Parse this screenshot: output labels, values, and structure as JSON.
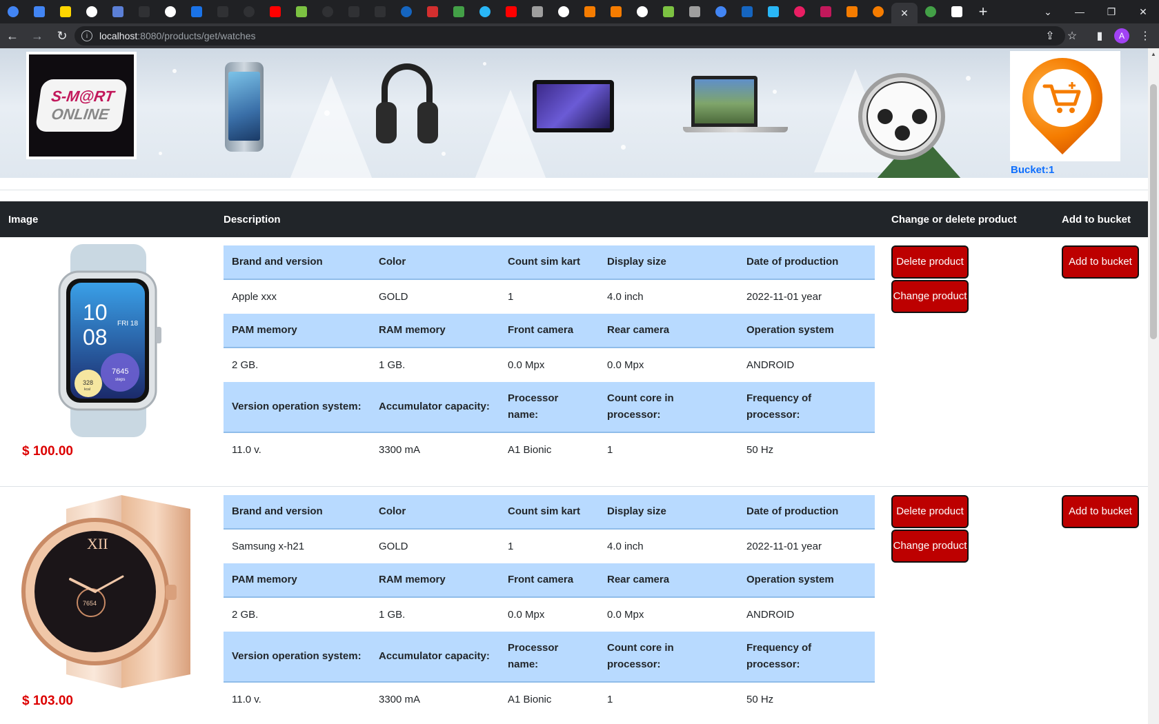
{
  "browser": {
    "url_host": "localhost",
    "url_path": ":8080/products/get/watches",
    "profile_initial": "A",
    "tab_favicon_colors": [
      "#4285f4",
      "#4285f4",
      "#ffd600",
      "#fff",
      "#5b7fd6",
      "#303134",
      "#fff",
      "#1a73e8",
      "#303134",
      "#303134",
      "#ff0000",
      "#7cc242",
      "#303134",
      "#303134",
      "#303134",
      "#1565c0",
      "#d32f2f",
      "#43a047",
      "#29b6f6",
      "#ff0000",
      "#9e9e9e",
      "#fff",
      "#f57c00",
      "#f57c00",
      "#fff",
      "#7cc242",
      "#9e9e9e",
      "#4285f4",
      "#1565c0",
      "#29b6f6",
      "#e91e63",
      "#c2185b",
      "#f57c00",
      "#f57c00"
    ]
  },
  "header": {
    "logo_line1": "S-M@RT",
    "logo_line2": "ONLINE",
    "bucket_label": "Bucket:1"
  },
  "table": {
    "headers": {
      "image": "Image",
      "description": "Description",
      "change_delete": "Change or delete product",
      "add_bucket": "Add to bucket"
    },
    "spec_labels": {
      "row1": [
        "Brand and version",
        "Color",
        "Count sim kart",
        "Display size",
        "Date of production"
      ],
      "row2": [
        "PAM memory",
        "RAM memory",
        "Front camera",
        "Rear camera",
        "Operation system"
      ],
      "row3": [
        "Version operation system:",
        "Accumulator capacity:",
        "Processor name:",
        "Count core in processor:",
        "Frequency of processor:"
      ]
    },
    "buttons": {
      "delete": "Delete product",
      "change": "Change product",
      "add": "Add to bucket"
    },
    "products": [
      {
        "price": "$ 100.00",
        "row1": [
          "Apple xxx",
          "GOLD",
          "1",
          "4.0 inch",
          "2022-11-01 year"
        ],
        "row2": [
          "2 GB.",
          "1 GB.",
          "0.0 Mpx",
          "0.0 Mpx",
          "ANDROID"
        ],
        "row3": [
          "11.0 v.",
          "3300 mA",
          "A1 Bionic",
          "1",
          "50 Hz"
        ],
        "watch_time_h": "10",
        "watch_time_m": "08",
        "watch_date": "FRI 18",
        "watch_steps": "7645",
        "watch_steps_unit": "steps",
        "watch_kcal": "328",
        "watch_kcal_unit": "kcal"
      },
      {
        "price": "$ 103.00",
        "row1": [
          "Samsung x-h21",
          "GOLD",
          "1",
          "4.0 inch",
          "2022-11-01 year"
        ],
        "row2": [
          "2 GB.",
          "1 GB.",
          "0.0 Mpx",
          "0.0 Mpx",
          "ANDROID"
        ],
        "row3": [
          "11.0 v.",
          "3300 mA",
          "A1 Bionic",
          "1",
          "50 Hz"
        ],
        "watch_numeral": "XII",
        "watch_sub": "7654"
      }
    ]
  }
}
